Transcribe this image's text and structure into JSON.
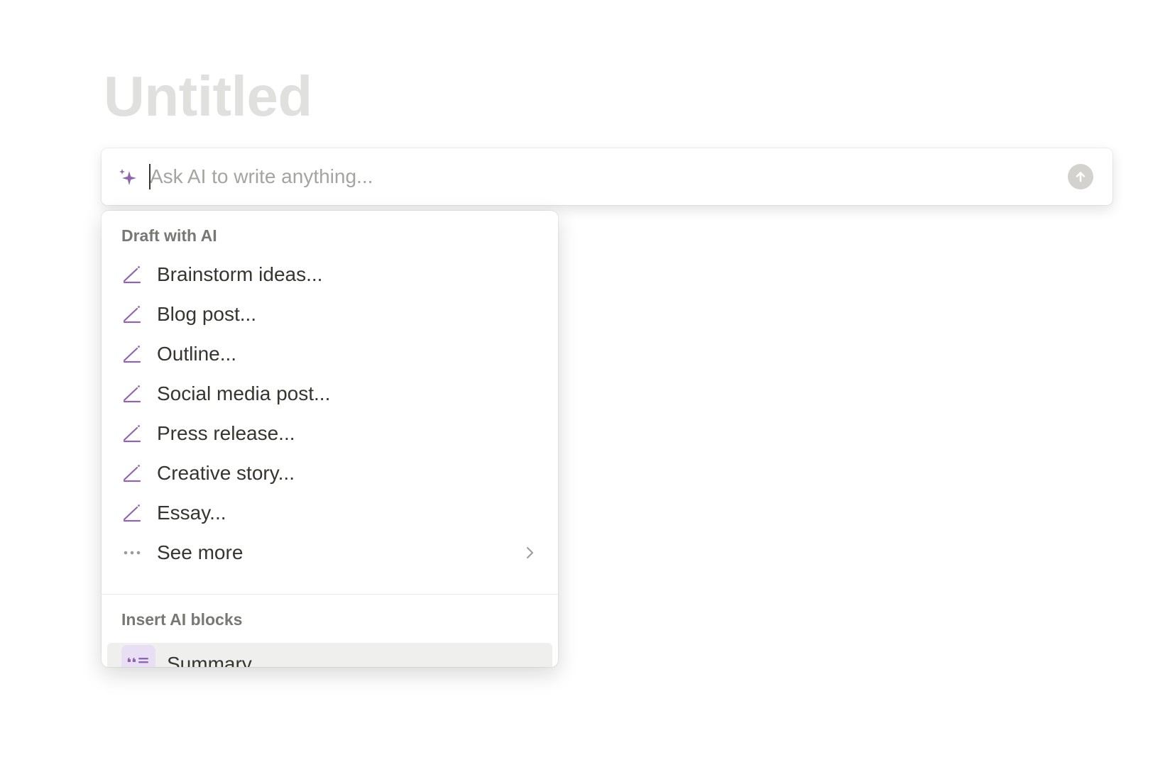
{
  "page": {
    "title": "Untitled"
  },
  "ai_bar": {
    "placeholder": "Ask AI to write anything...",
    "icon": "sparkle-icon",
    "submit_icon": "arrow-up-icon"
  },
  "menu": {
    "draft_section": {
      "header": "Draft with AI",
      "items": [
        {
          "label": "Brainstorm ideas...",
          "icon": "pencil-icon"
        },
        {
          "label": "Blog post...",
          "icon": "pencil-icon"
        },
        {
          "label": "Outline...",
          "icon": "pencil-icon"
        },
        {
          "label": "Social media post...",
          "icon": "pencil-icon"
        },
        {
          "label": "Press release...",
          "icon": "pencil-icon"
        },
        {
          "label": "Creative story...",
          "icon": "pencil-icon"
        },
        {
          "label": "Essay...",
          "icon": "pencil-icon"
        }
      ],
      "see_more": {
        "label": "See more",
        "icon": "more-dots-icon"
      }
    },
    "insert_section": {
      "header": "Insert AI blocks",
      "items": [
        {
          "label": "Summary",
          "icon": "quote-list-icon"
        }
      ]
    }
  },
  "colors": {
    "accent": "#9065b0",
    "title_placeholder": "#e0e0de",
    "text": "#37352f",
    "muted": "#787774"
  }
}
